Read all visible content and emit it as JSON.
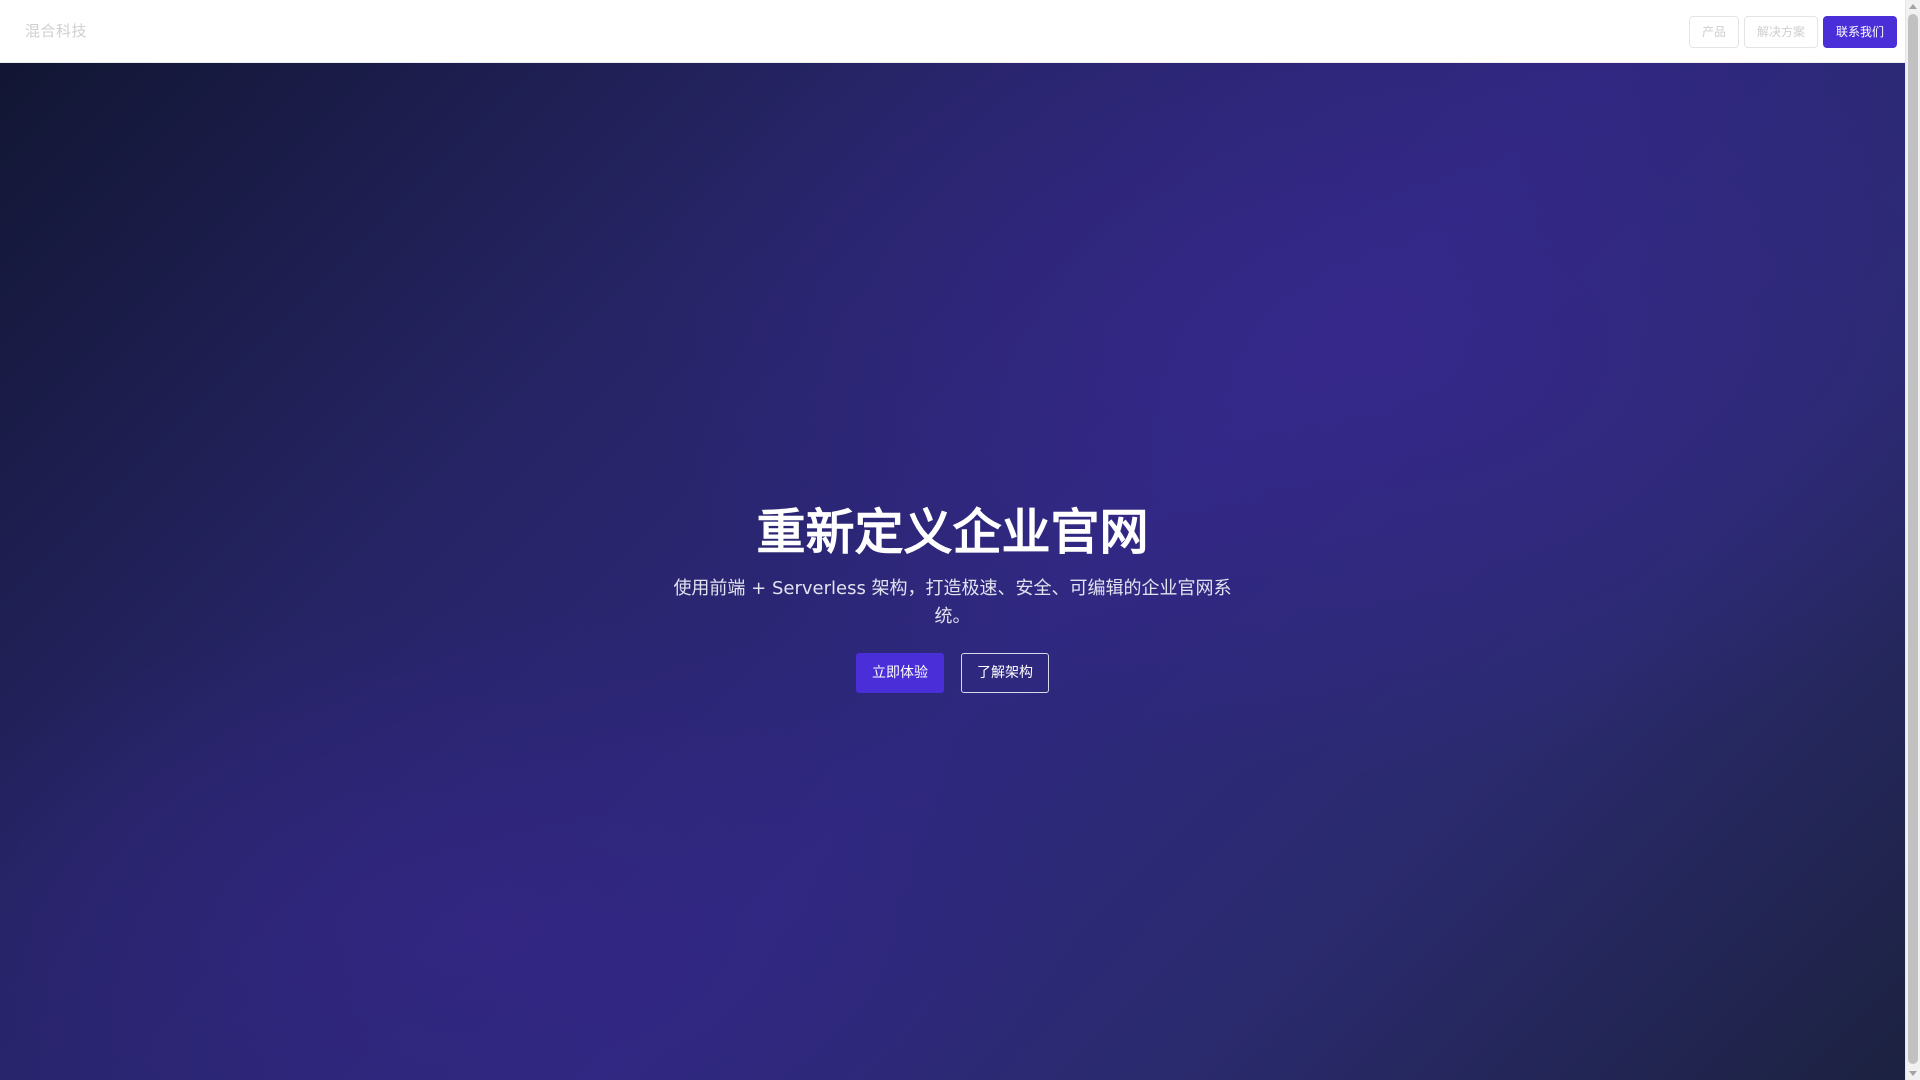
{
  "navbar": {
    "brand": "混合科技",
    "items": [
      {
        "label": "产品"
      },
      {
        "label": "解决方案"
      }
    ],
    "contact_label": "联系我们"
  },
  "hero": {
    "title": "重新定义企业官网",
    "subtitle": "使用前端 + Serverless 架构，打造极速、安全、可编辑的企业官网系统。",
    "primary_cta": "立即体验",
    "secondary_cta": "了解架构"
  },
  "colors": {
    "accent": "#4a2fd8",
    "hero_dark": "#121633",
    "hero_mid": "#2e287e"
  }
}
